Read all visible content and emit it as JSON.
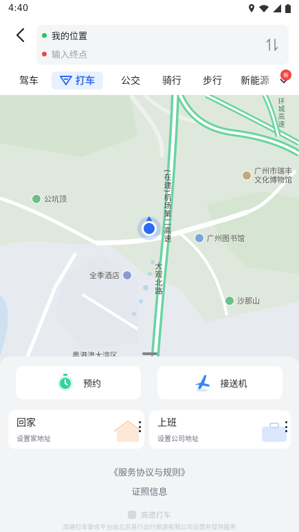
{
  "status_bar": {
    "time": "4:40"
  },
  "route": {
    "start_label": "我的位置",
    "end_placeholder": "输入终点"
  },
  "tabs": [
    {
      "label": "驾车"
    },
    {
      "label": "打车"
    },
    {
      "label": "公交"
    },
    {
      "label": "骑行"
    },
    {
      "label": "步行"
    },
    {
      "label": "新能源"
    }
  ],
  "new_badge": "新",
  "map": {
    "pois": {
      "museum": "广州市瑞丰文化博物馆",
      "library": "广州图书馆",
      "gongkengding": "公坑顶",
      "hotel": "全季酒店",
      "shanashan": "沙那山",
      "bay_area": "粤港澳大湾区",
      "road_top_right": "环城高速"
    },
    "road_name": "(在建)机场第二高速",
    "road_name2": "大观北路"
  },
  "sheet": {
    "reserve_label": "预约",
    "airport_label": "接送机",
    "home": {
      "title": "回家",
      "subtitle": "设置家地址"
    },
    "work": {
      "title": "上班",
      "subtitle": "设置公司地址"
    },
    "agreement": "《服务协议与规则》",
    "license": "证照信息",
    "footer_logo": "高德打车",
    "footer_note": "高德打车聚合平台由北京易行出行旅游有限公司运营并提供服务"
  },
  "colors": {
    "accent": "#2f6bf2",
    "start_dot": "#22c55e",
    "end_dot": "#ef4444",
    "road_highlight": "#68d4a0"
  }
}
